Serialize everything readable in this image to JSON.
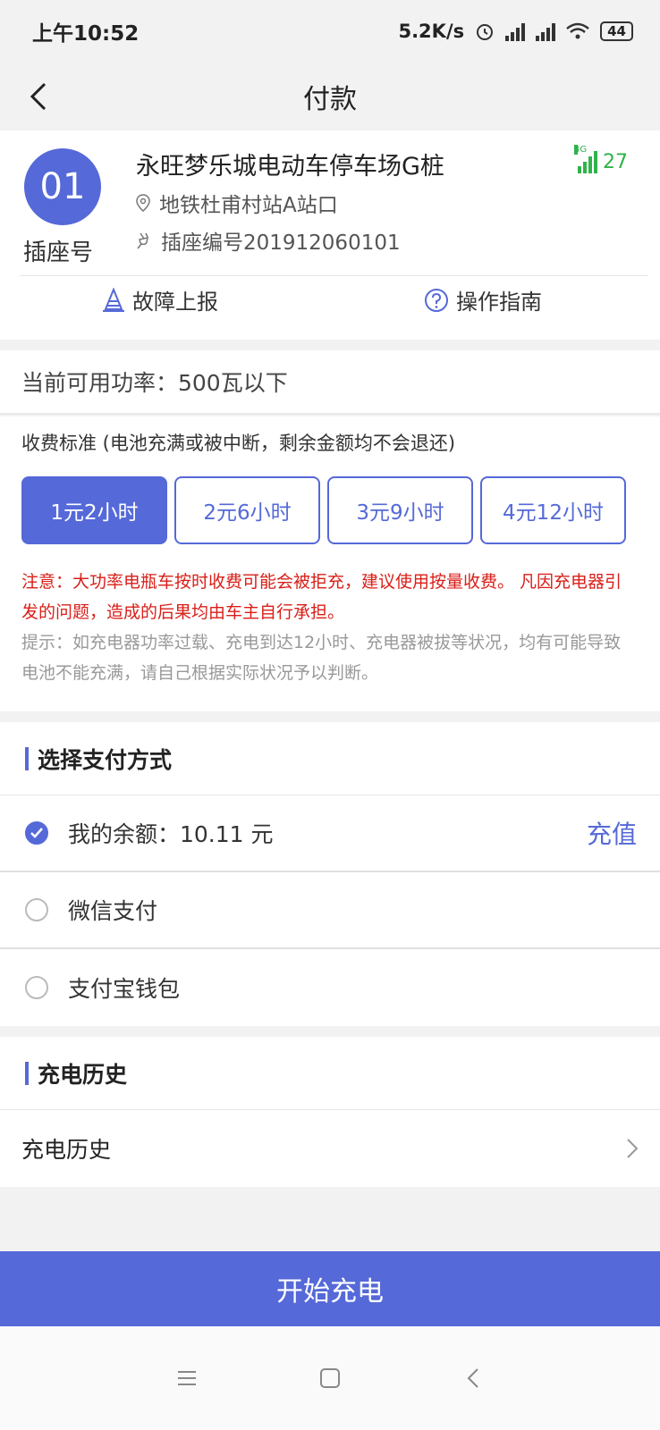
{
  "status": {
    "time": "上午10:52",
    "network_speed": "5.2K/s",
    "battery": "44"
  },
  "nav": {
    "title": "付款"
  },
  "station": {
    "socket_number": "01",
    "socket_label": "插座号",
    "name": "永旺梦乐城电动车停车场G桩",
    "location": "地铁杜甫村站A站口",
    "socket_code": "插座编号201912060101",
    "signal_type": "4G",
    "signal_value": "27",
    "fault_report": "故障上报",
    "guide": "操作指南"
  },
  "power": {
    "label": "当前可用功率：500瓦以下"
  },
  "fee": {
    "title": "收费标准 (电池充满或被中断，剩余金额均不会退还)",
    "plans": [
      "1元2小时",
      "2元6小时",
      "3元9小时",
      "4元12小时"
    ],
    "selected_plan": "1元2小时",
    "warning": "注意：大功率电瓶车按时收费可能会被拒充，建议使用按量收费。 凡因充电器引发的问题，造成的后果均由车主自行承担。",
    "tip": "提示：如充电器功率过载、充电到达12小时、充电器被拔等状况，均有可能导致电池不能充满，请自己根据实际状况予以判断。"
  },
  "payment": {
    "section_title": "选择支付方式",
    "balance_label": "我的余额：10.11 元",
    "recharge_label": "充值",
    "wechat_label": "微信支付",
    "alipay_label": "支付宝钱包",
    "selected": "balance"
  },
  "history": {
    "section_title": "充电历史",
    "row_label": "充电历史"
  },
  "actions": {
    "start_label": "开始充电"
  },
  "colors": {
    "accent": "#5569d8",
    "warning": "#d91e18",
    "signal": "#2fb34a"
  }
}
